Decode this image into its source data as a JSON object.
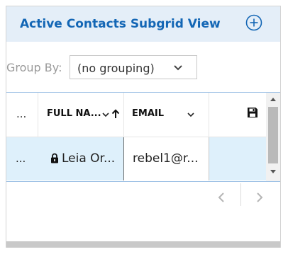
{
  "header": {
    "title": "Active Contacts Subgrid View",
    "add_icon": "plus-circle-icon"
  },
  "group_by": {
    "label": "Group By:",
    "selected": "(no grouping)"
  },
  "grid": {
    "columns": [
      {
        "label": "..."
      },
      {
        "label": "FULL NA...",
        "sort": "ascending"
      },
      {
        "label": "EMAIL"
      },
      {
        "icon": "save-icon"
      }
    ],
    "rows": [
      {
        "more": "...",
        "full_name": "Leia Or...",
        "email": "rebel1@r...",
        "locked": true
      }
    ]
  },
  "colors": {
    "accent": "#1366b5",
    "header_bg": "#e4eef8",
    "selected_row": "#def0fb"
  }
}
